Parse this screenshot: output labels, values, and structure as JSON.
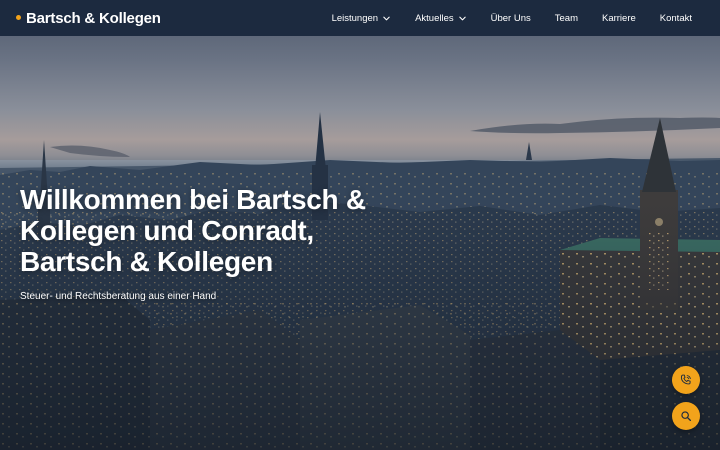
{
  "header": {
    "logo_text": "Bartsch & Kollegen",
    "nav": [
      {
        "label": "Leistungen",
        "has_dropdown": true
      },
      {
        "label": "Aktuelles",
        "has_dropdown": true
      },
      {
        "label": "Über Uns",
        "has_dropdown": false
      },
      {
        "label": "Team",
        "has_dropdown": false
      },
      {
        "label": "Karriere",
        "has_dropdown": false
      },
      {
        "label": "Kontakt",
        "has_dropdown": false
      }
    ]
  },
  "hero": {
    "title_lines": [
      "Willkommen bei Bartsch &",
      "Kollegen und Conradt,",
      "Bartsch & Kollegen"
    ],
    "subtitle": "Steuer- und Rechtsberatung aus einer Hand"
  },
  "floating_actions": {
    "phone_icon": "phone-icon",
    "search_icon": "search-icon"
  },
  "colors": {
    "nav_bg": "#1c2a3f",
    "accent": "#f2a31b",
    "text": "#ffffff"
  }
}
